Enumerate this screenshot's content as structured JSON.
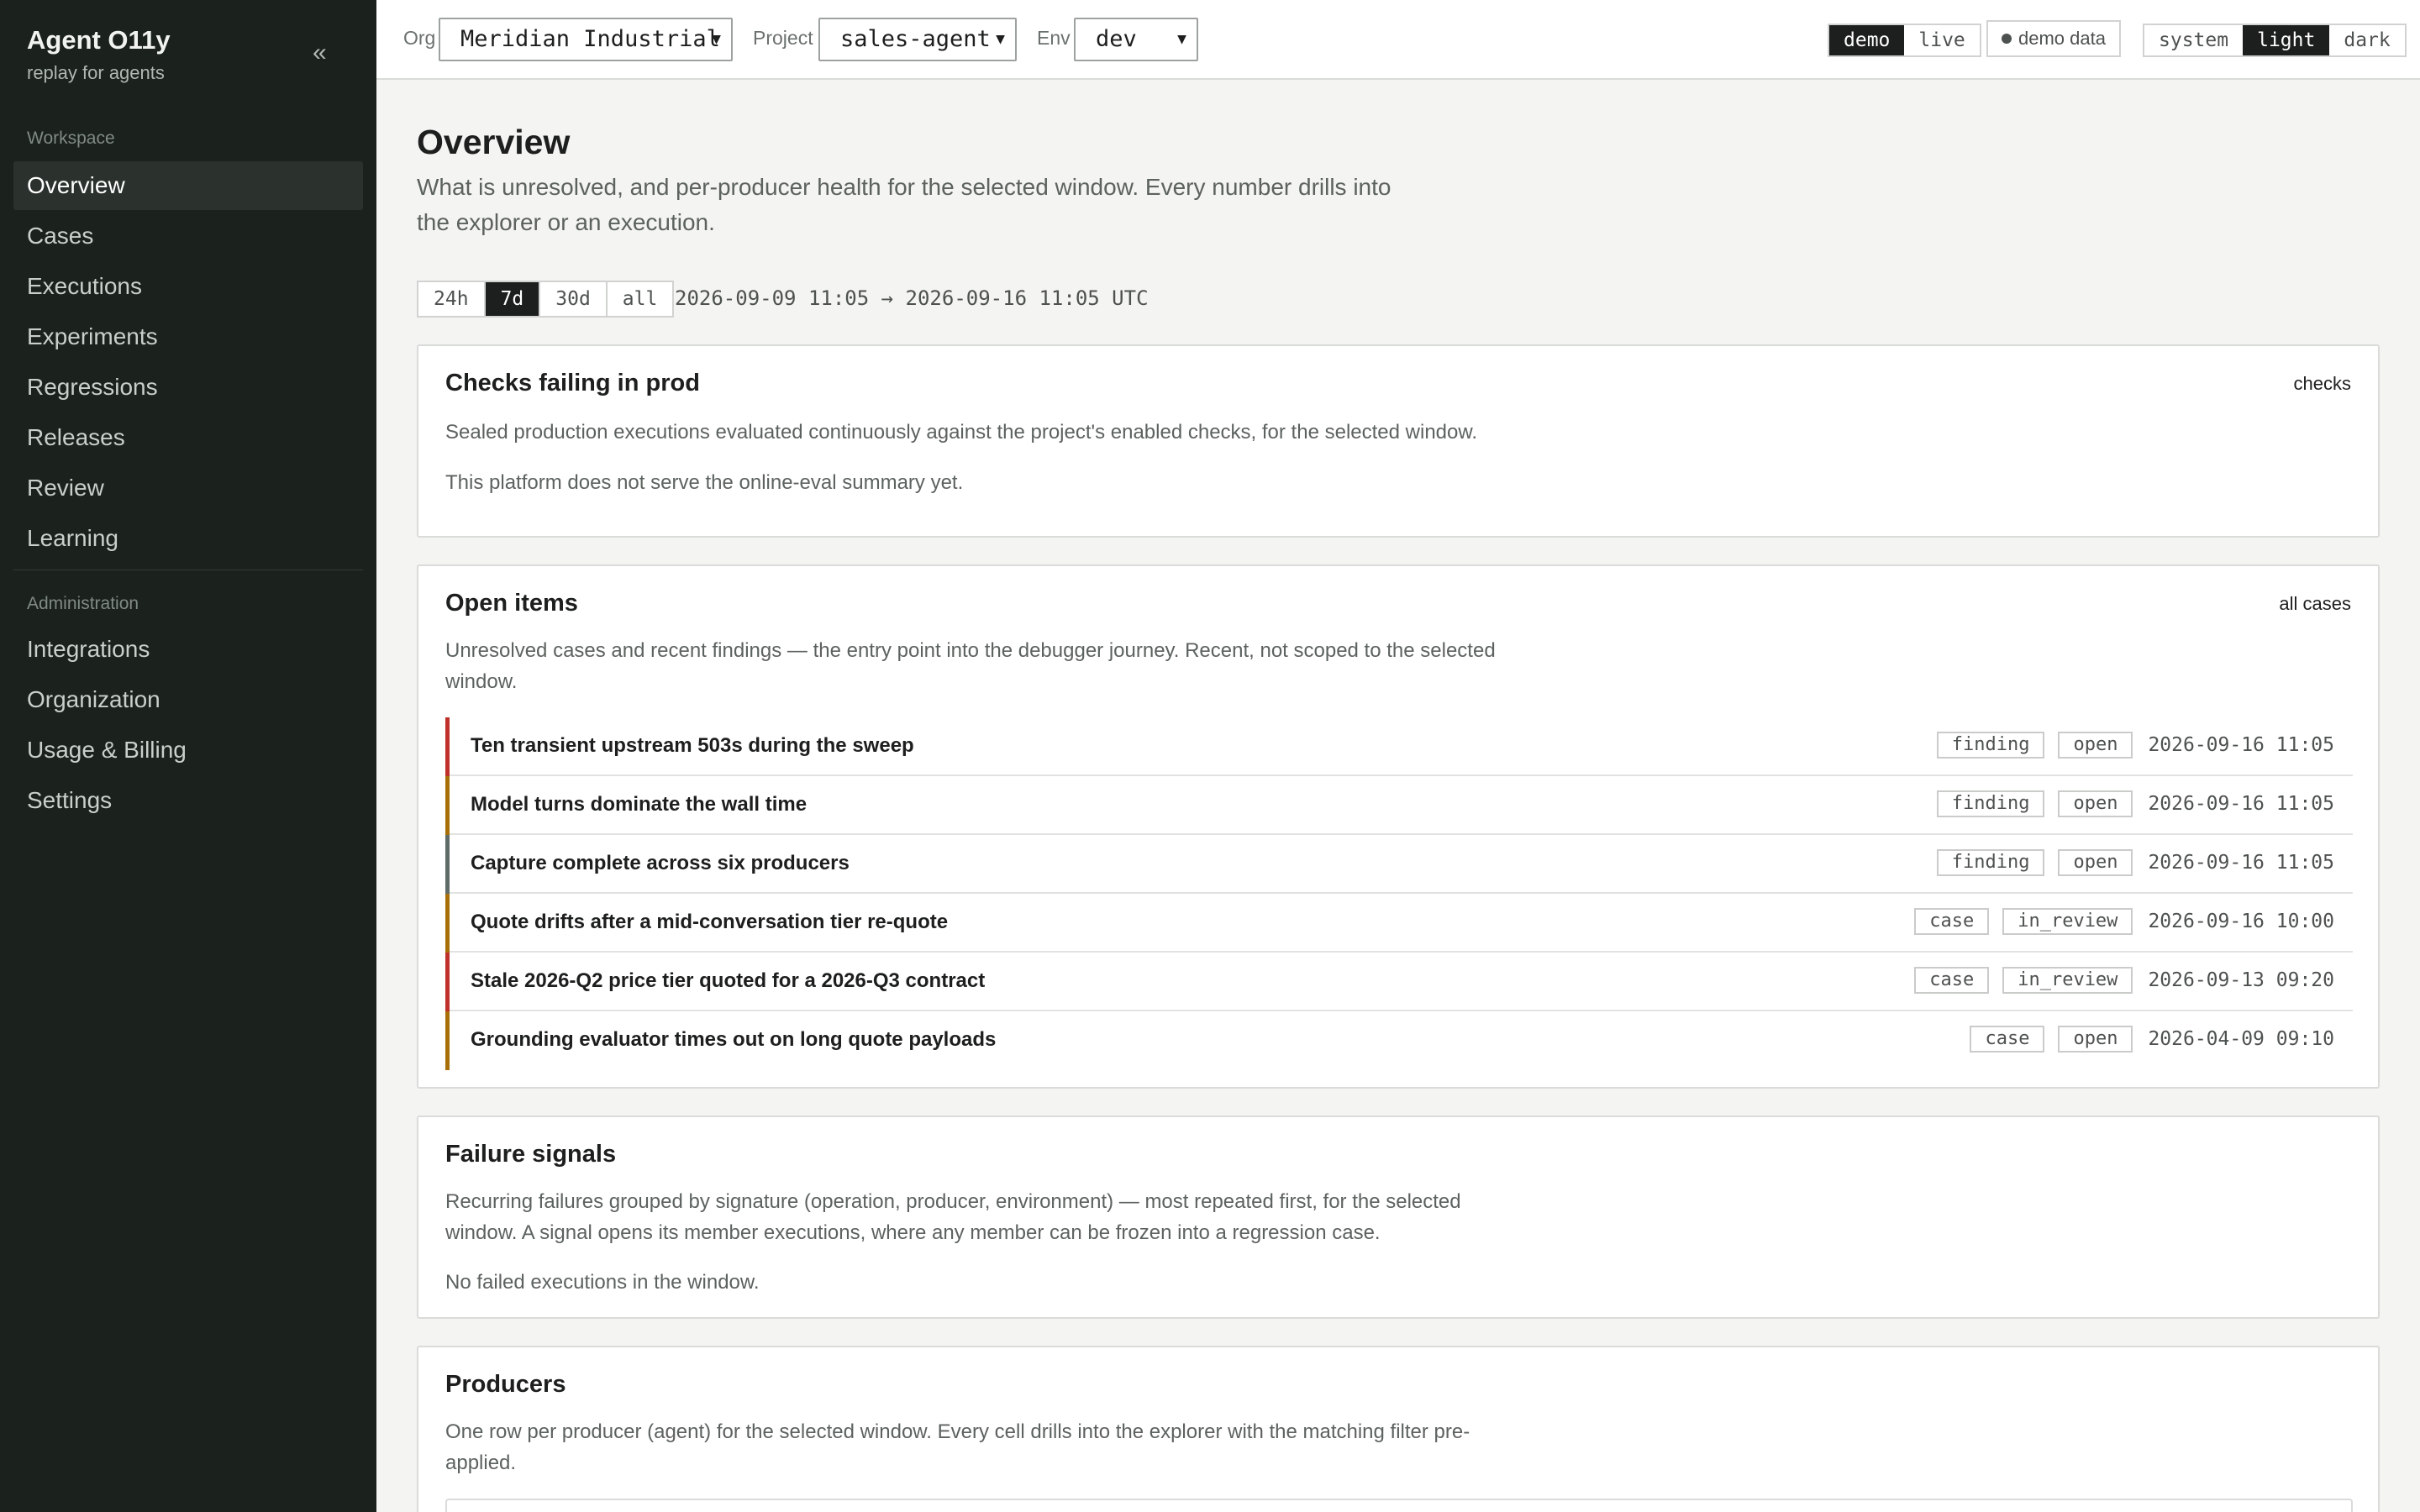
{
  "brand": {
    "title": "Agent O11y",
    "subtitle": "replay for agents",
    "collapse_glyph": "«"
  },
  "sidebar": {
    "workspace_label": "Workspace",
    "workspace_items": [
      {
        "label": "Overview",
        "active": true
      },
      {
        "label": "Cases"
      },
      {
        "label": "Executions"
      },
      {
        "label": "Experiments"
      },
      {
        "label": "Regressions"
      },
      {
        "label": "Releases"
      },
      {
        "label": "Review"
      },
      {
        "label": "Learning"
      }
    ],
    "admin_label": "Administration",
    "admin_items": [
      {
        "label": "Integrations"
      },
      {
        "label": "Organization"
      },
      {
        "label": "Usage & Billing"
      },
      {
        "label": "Settings"
      }
    ]
  },
  "topbar": {
    "org": {
      "label": "Org",
      "value": "Meridian Industrial"
    },
    "project": {
      "label": "Project",
      "value": "sales-agent"
    },
    "env": {
      "label": "Env",
      "value": "dev"
    },
    "mode": {
      "options": [
        "demo",
        "live"
      ],
      "selected": "demo"
    },
    "demo_badge": "demo data",
    "theme": {
      "options": [
        "system",
        "light",
        "dark"
      ],
      "selected": "light"
    }
  },
  "main": {
    "title": "Overview",
    "description": "What is unresolved, and per-producer health for the selected window. Every number drills into the explorer or an execution.",
    "ranges": [
      "24h",
      "7d",
      "30d",
      "all"
    ],
    "selected_range": "7d",
    "window": "2026-09-09 11:05 → 2026-09-16 11:05 UTC"
  },
  "checks_card": {
    "title": "Checks failing in prod",
    "link": "checks",
    "description": "Sealed production executions evaluated continuously against the project's enabled checks, for the selected window.",
    "note": "This platform does not serve the online-eval summary yet."
  },
  "open_items_card": {
    "title": "Open items",
    "link": "all cases",
    "description": "Unresolved cases and recent findings — the entry point into the debugger journey. Recent, not scoped to the selected window.",
    "items": [
      {
        "title": "Ten transient upstream 503s during the sweep",
        "kind": "finding",
        "status": "open",
        "time": "2026-09-16 11:05",
        "severity_color": "#c0302a"
      },
      {
        "title": "Model turns dominate the wall time",
        "kind": "finding",
        "status": "open",
        "time": "2026-09-16 11:05",
        "severity_color": "#a86f08"
      },
      {
        "title": "Capture complete across six producers",
        "kind": "finding",
        "status": "open",
        "time": "2026-09-16 11:05",
        "severity_color": "#5f6b66"
      },
      {
        "title": "Quote drifts after a mid-conversation tier re-quote",
        "kind": "case",
        "status": "in_review",
        "time": "2026-09-16 10:00",
        "severity_color": "#a86f08"
      },
      {
        "title": "Stale 2026-Q2 price tier quoted for a 2026-Q3 contract",
        "kind": "case",
        "status": "in_review",
        "time": "2026-09-13 09:20",
        "severity_color": "#c0302a"
      },
      {
        "title": "Grounding evaluator times out on long quote payloads",
        "kind": "case",
        "status": "open",
        "time": "2026-04-09 09:10",
        "severity_color": "#a86f08"
      }
    ]
  },
  "failure_card": {
    "title": "Failure signals",
    "description": "Recurring failures grouped by signature (operation, producer, environment) — most repeated first, for the selected window. A signal opens its member executions, where any member can be frozen into a regression case.",
    "note": "No failed executions in the window."
  },
  "producers_card": {
    "title": "Producers",
    "description": "One row per producer (agent) for the selected window. Every cell drills into the explorer with the matching filter pre-applied."
  }
}
